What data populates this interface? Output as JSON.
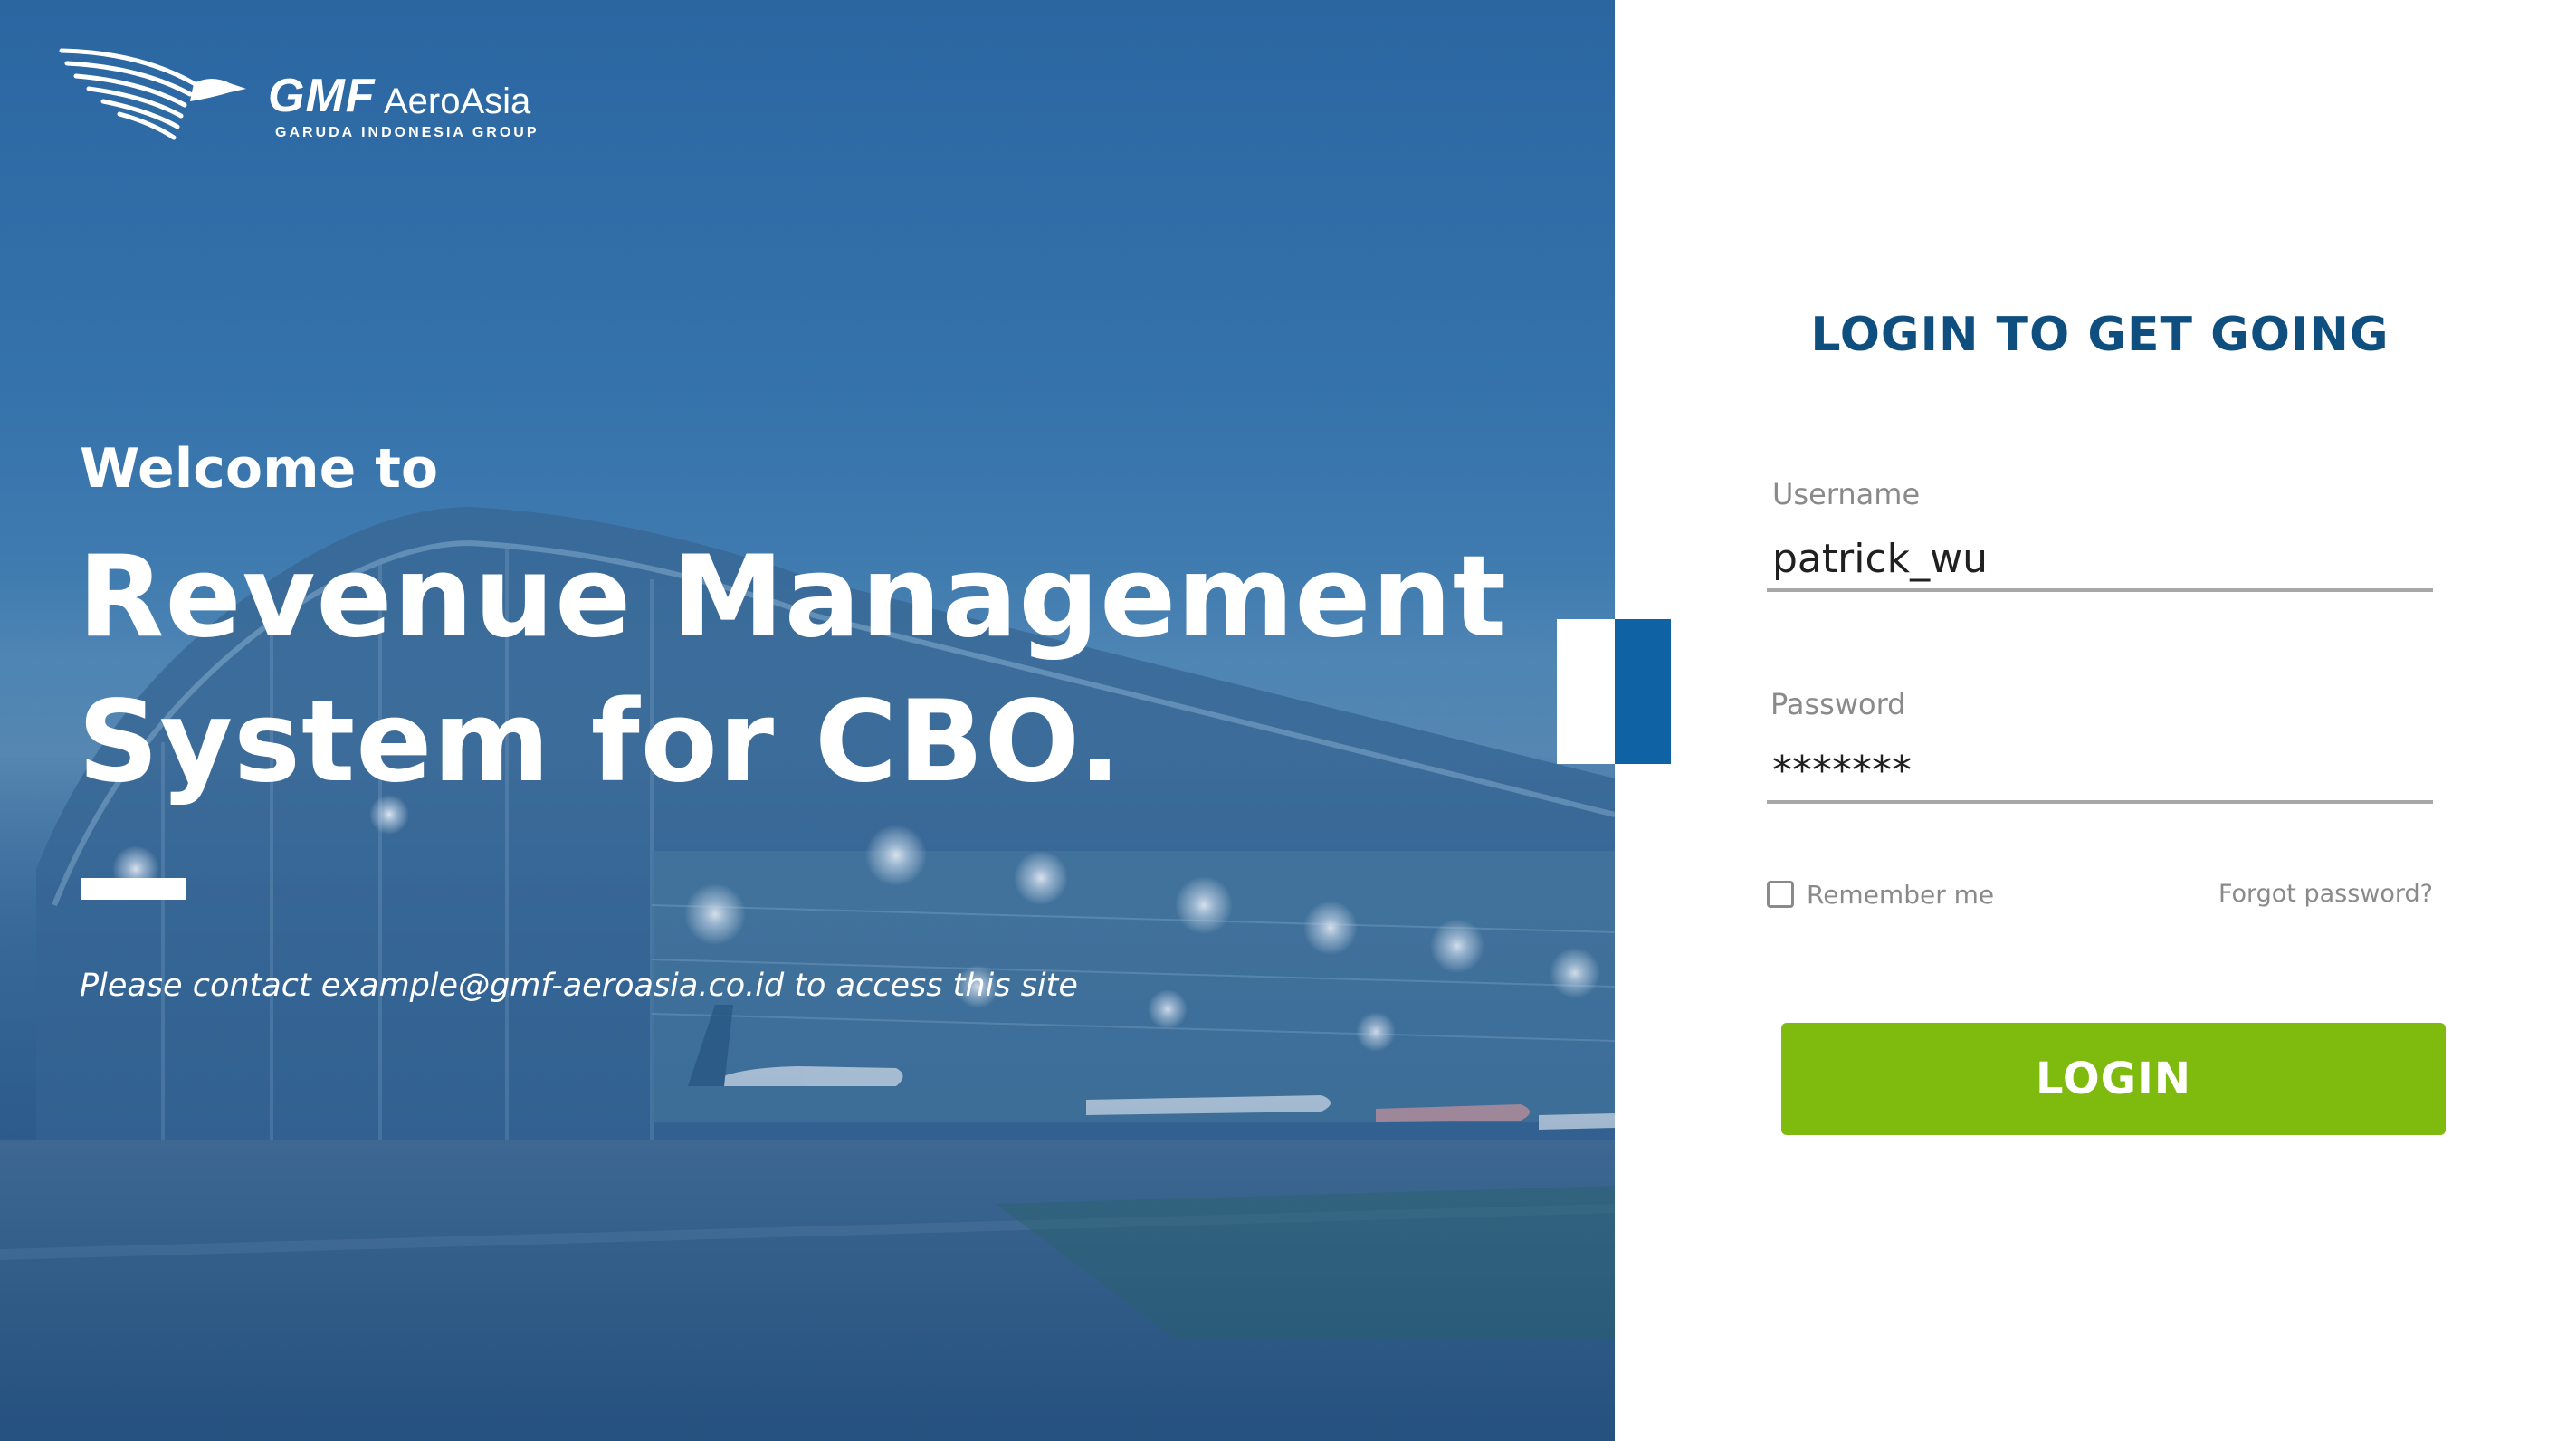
{
  "brand": {
    "logo_name": "GMF",
    "logo_suffix": "AeroAsia",
    "logo_tagline": "GARUDA INDONESIA GROUP"
  },
  "hero": {
    "welcome": "Welcome to",
    "title_line1": "Revenue Management",
    "title_line2": "System for CBO.",
    "contact_note": "Please contact example@gmf-aeroasia.co.id to access this site"
  },
  "login": {
    "heading": "LOGIN TO GET GOING",
    "username_label": "Username",
    "username_value": "patrick_wu",
    "password_label": "Password",
    "password_value": "*******",
    "remember_label": "Remember me",
    "remember_checked": false,
    "forgot_label": "Forgot password?",
    "submit_label": "LOGIN"
  },
  "colors": {
    "heading_blue": "#0f4f80",
    "accent_blue": "#0f62a3",
    "button_green": "#7fba0e",
    "label_gray": "#8a8a8a"
  },
  "icons": {
    "logo_mark": "garuda-bird-icon"
  }
}
